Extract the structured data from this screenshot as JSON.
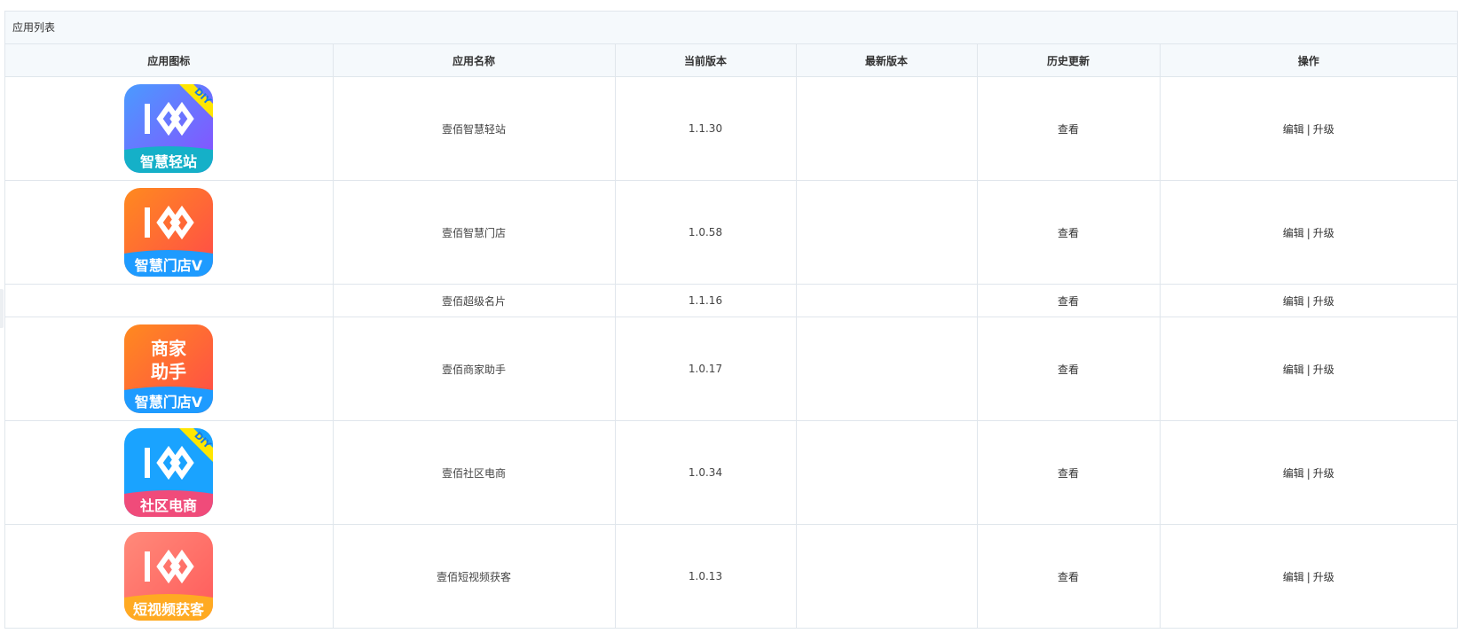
{
  "panel": {
    "title": "应用列表"
  },
  "table": {
    "headers": [
      "应用图标",
      "应用名称",
      "当前版本",
      "最新版本",
      "历史更新",
      "操作"
    ],
    "rows": [
      {
        "name": "壹佰智慧轻站",
        "version": "1.1.30",
        "latest": "",
        "history": "查看",
        "edit": "编辑",
        "upgrade": "升级",
        "icon": {
          "label": "智慧轻站",
          "badge": "DIY",
          "top": "#4a9bff",
          "bottom": "#8a4dff",
          "banner": "#15b0c8",
          "badge_color": "#ffe600"
        }
      },
      {
        "name": "壹佰智慧门店",
        "version": "1.0.58",
        "latest": "",
        "history": "查看",
        "edit": "编辑",
        "upgrade": "升级",
        "icon": {
          "label": "智慧门店V",
          "badge": "",
          "top": "#ff8a1f",
          "bottom": "#ff4a4a",
          "banner": "#1e9bff"
        }
      },
      {
        "name": "壹佰超级名片",
        "version": "1.1.16",
        "latest": "",
        "history": "查看",
        "edit": "编辑",
        "upgrade": "升级",
        "icon": null
      },
      {
        "name": "壹佰商家助手",
        "version": "1.0.17",
        "latest": "",
        "history": "查看",
        "edit": "编辑",
        "upgrade": "升级",
        "icon": {
          "label": "智慧门店V",
          "badge": "",
          "top": "#ff8a1f",
          "bottom": "#ff4a4a",
          "banner": "#1e9bff",
          "text_top": "商家",
          "text_bottom": "助手"
        }
      },
      {
        "name": "壹佰社区电商",
        "version": "1.0.34",
        "latest": "",
        "history": "查看",
        "edit": "编辑",
        "upgrade": "升级",
        "icon": {
          "label": "社区电商",
          "badge": "DIY",
          "top": "#1aa3ff",
          "bottom": "#1aa3ff",
          "banner": "#f04b7a",
          "badge_color": "#ffe600"
        }
      },
      {
        "name": "壹佰短视频获客",
        "version": "1.0.13",
        "latest": "",
        "history": "查看",
        "edit": "编辑",
        "upgrade": "升级",
        "icon": {
          "label": "短视频获客",
          "badge": "",
          "top": "#ff8a7a",
          "bottom": "#ff5a5a",
          "banner": "#ffaa22"
        }
      }
    ]
  },
  "icons": {
    "logo": "double-ring-logo-icon",
    "badge": "diy-ribbon-icon"
  }
}
